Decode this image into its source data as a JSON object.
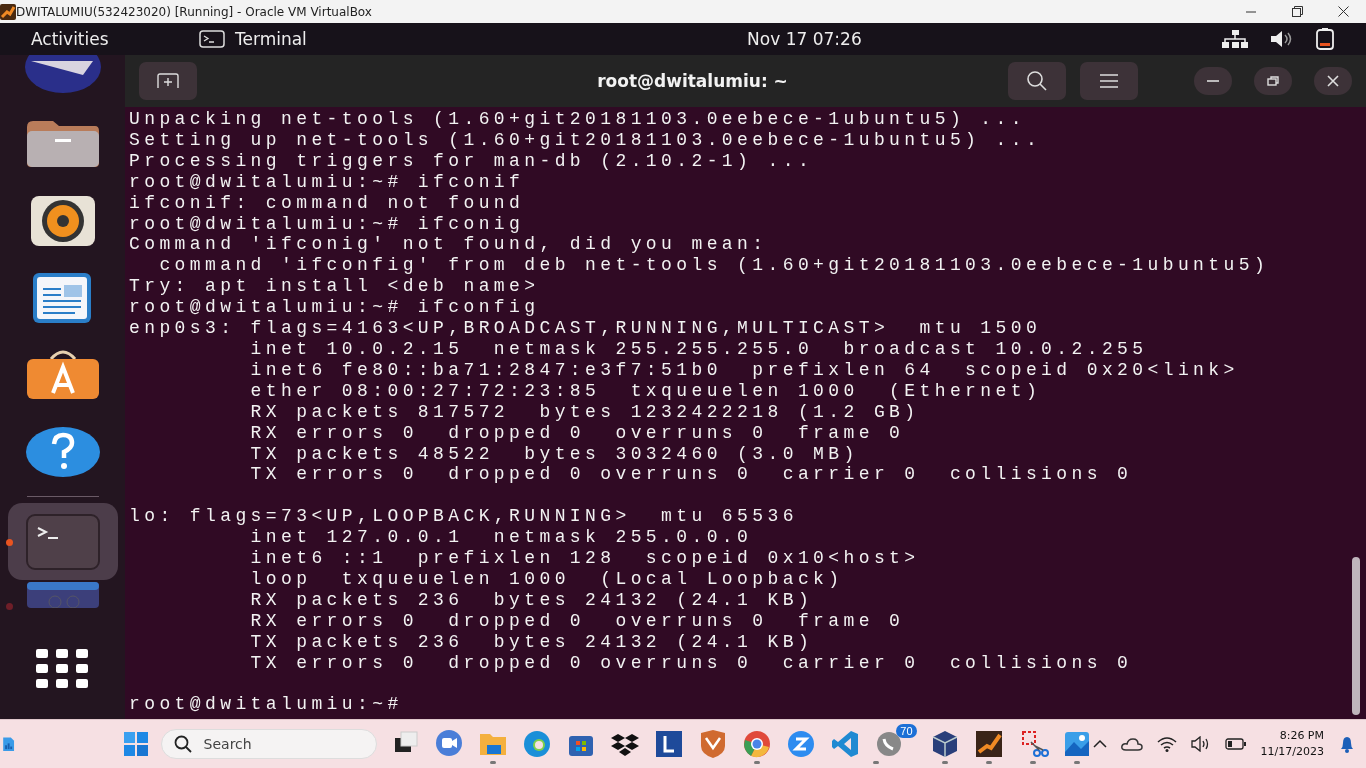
{
  "host_window": {
    "title": "DWITALUMIU(532423020) [Running] - Oracle VM VirtualBox"
  },
  "top_bar": {
    "activities": "Activities",
    "app_name": "Terminal",
    "clock": "Nov 17  07:26"
  },
  "dock": {
    "items": [
      {
        "kind": "partial-top",
        "selected": false,
        "running": false
      },
      {
        "kind": "files",
        "selected": false,
        "running": false
      },
      {
        "kind": "music",
        "selected": false,
        "running": false
      },
      {
        "kind": "writer",
        "selected": false,
        "running": false
      },
      {
        "kind": "software",
        "selected": false,
        "running": false
      },
      {
        "kind": "help",
        "selected": false,
        "running": false
      },
      {
        "kind": "terminal",
        "selected": true,
        "running": true
      },
      {
        "kind": "drive",
        "selected": false,
        "running": true
      },
      {
        "kind": "apps",
        "selected": false,
        "running": false
      }
    ]
  },
  "terminal": {
    "title": "root@dwitalumiu: ~",
    "blocks": [
      [
        "Unpacking net-tools (1.60+git20181103.0eebece-1ubuntu5) ...",
        "Setting up net-tools (1.60+git20181103.0eebece-1ubuntu5) ...",
        "Processing triggers for man-db (2.10.2-1) ...",
        "root@dwitalumiu:~# ifconif",
        "ifconif: command not found",
        "root@dwitalumiu:~# ifconig",
        "Command 'ifconig' not found, did you mean:",
        "  command 'ifconfig' from deb net-tools (1.60+git20181103.0eebece-1ubuntu5)",
        "Try: apt install <deb name>",
        "root@dwitalumiu:~# ifconfig",
        "enp0s3: flags=4163<UP,BROADCAST,RUNNING,MULTICAST>  mtu 1500",
        "        inet 10.0.2.15  netmask 255.255.255.0  broadcast 10.0.2.255",
        "        inet6 fe80::ba71:2847:e3f7:51b0  prefixlen 64  scopeid 0x20<link>",
        "        ether 08:00:27:72:23:85  txqueuelen 1000  (Ethernet)",
        "        RX packets 817572  bytes 1232422218 (1.2 GB)",
        "        RX errors 0  dropped 0  overruns 0  frame 0",
        "        TX packets 48522  bytes 3032460 (3.0 MB)",
        "        TX errors 0  dropped 0 overruns 0  carrier 0  collisions 0"
      ],
      [
        "lo: flags=73<UP,LOOPBACK,RUNNING>  mtu 65536",
        "        inet 127.0.0.1  netmask 255.0.0.0",
        "        inet6 ::1  prefixlen 128  scopeid 0x10<host>",
        "        loop  txqueuelen 1000  (Local Loopback)",
        "        RX packets 236  bytes 24132 (24.1 KB)",
        "        RX errors 0  dropped 0  overruns 0  frame 0",
        "        TX packets 236  bytes 24132 (24.1 KB)",
        "        TX errors 0  dropped 0 overruns 0  carrier 0  collisions 0"
      ],
      [
        "root@dwitalumiu:~#"
      ]
    ]
  },
  "taskbar": {
    "search": {
      "placeholder": "Search"
    },
    "apps": [
      {
        "kind": "task-view",
        "running": false
      },
      {
        "kind": "meet",
        "running": false
      },
      {
        "kind": "folder",
        "running": true
      },
      {
        "kind": "edge",
        "running": false
      },
      {
        "kind": "store",
        "running": false
      },
      {
        "kind": "dropbox",
        "running": false
      },
      {
        "kind": "letter",
        "running": false
      },
      {
        "kind": "shield",
        "running": false
      },
      {
        "kind": "chrome",
        "running": true
      },
      {
        "kind": "zoom",
        "running": false
      },
      {
        "kind": "code",
        "running": false
      },
      {
        "kind": "chat",
        "running": true,
        "badge": "70"
      },
      {
        "kind": "cube",
        "running": true
      },
      {
        "kind": "g4",
        "running": true
      },
      {
        "kind": "snip",
        "running": true
      },
      {
        "kind": "photos",
        "running": true
      }
    ],
    "time": "8:26 PM",
    "date": "11/17/2023"
  }
}
